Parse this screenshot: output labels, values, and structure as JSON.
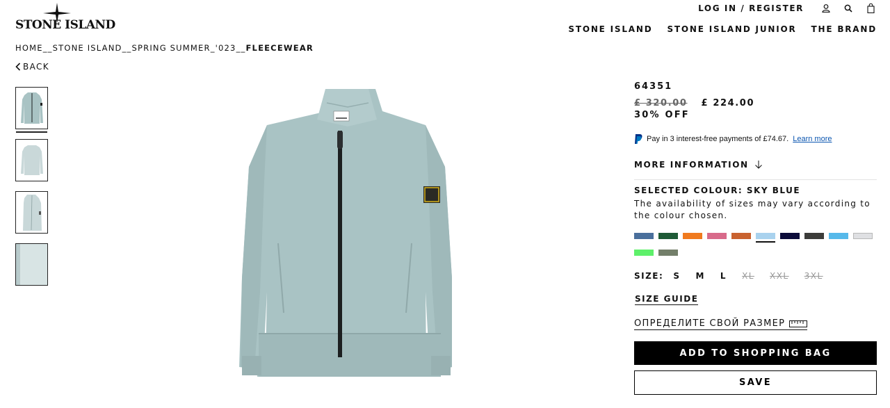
{
  "brand": {
    "logo_text": "STONE ISLAND"
  },
  "header": {
    "login_label": "LOG IN / REGISTER",
    "icons": [
      "user-icon",
      "search-icon",
      "shopping-bag-icon"
    ],
    "nav": [
      "STONE ISLAND",
      "STONE ISLAND JUNIOR",
      "THE BRAND"
    ]
  },
  "breadcrumb": {
    "items": [
      "HOME",
      "STONE ISLAND",
      "SPRING SUMMER_'023"
    ],
    "separator": "__",
    "current": "FLEECEWEAR"
  },
  "back_label": "BACK",
  "gallery": {
    "thumb_count": 4,
    "active_index": 0
  },
  "product": {
    "code": "64351",
    "price_old": "£ 320.00",
    "price_new": "£ 224.00",
    "discount": "30% OFF",
    "paypal_text": "Pay in 3 interest-free payments of £74.67.",
    "paypal_link": "Learn more",
    "more_info_label": "MORE INFORMATION",
    "selected_colour": "SELECTED COLOUR: SKY BLUE",
    "availability_note": "The availability of sizes may vary according to the colour chosen.",
    "colours": [
      "#4a6f9c",
      "#1e5a36",
      "#f07a1e",
      "#d86a8a",
      "#c9622f",
      "#a9d2ee",
      "#0c0c3a",
      "#3c3c3a",
      "#56b9ea",
      "#dfe0e3",
      "#5ef06a",
      "#737f6a"
    ],
    "selected_colour_index": 5,
    "size_label": "SIZE:",
    "sizes": [
      {
        "label": "S",
        "available": true
      },
      {
        "label": "M",
        "available": true
      },
      {
        "label": "L",
        "available": true
      },
      {
        "label": "XL",
        "available": false
      },
      {
        "label": "XXL",
        "available": false
      },
      {
        "label": "3XL",
        "available": false
      }
    ],
    "size_guide_label": "SIZE GUIDE",
    "find_size_label": "ОПРЕДЕЛИТЕ СВОЙ РАЗМЕР",
    "add_to_bag_label": "ADD TO SHOPPING BAG",
    "save_label": "SAVE"
  },
  "colors": {
    "garment": "#a9c3c4",
    "garment_shade": "#98b3b4",
    "zip": "#1c1f20"
  }
}
